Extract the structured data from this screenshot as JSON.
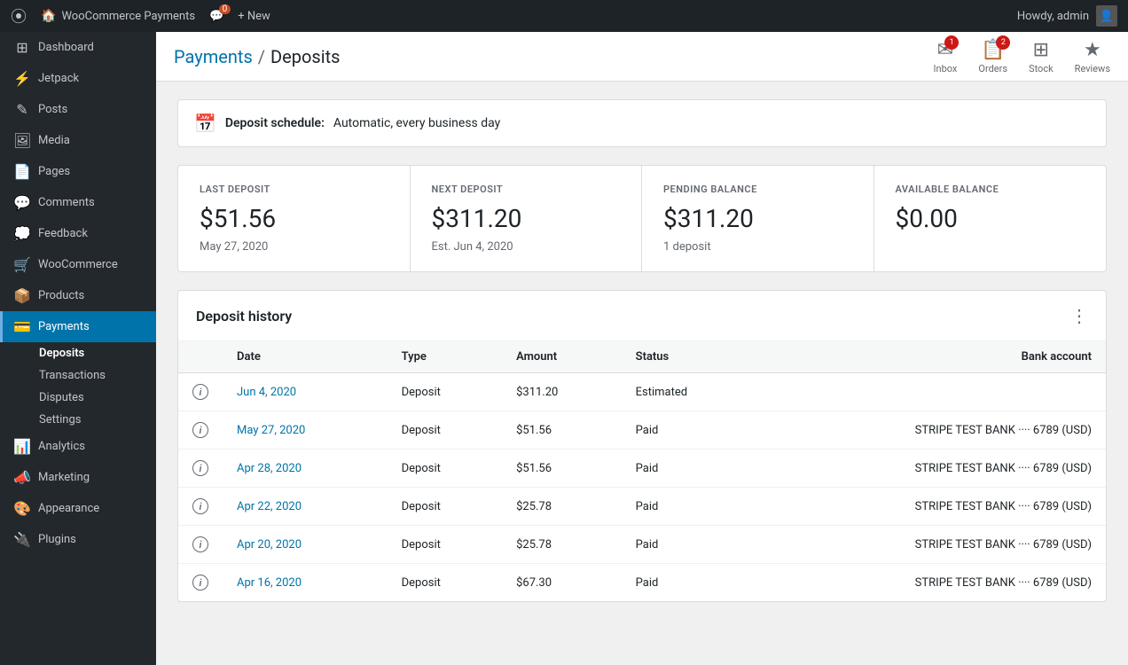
{
  "adminBar": {
    "logo": "W",
    "siteName": "WooCommerce Payments",
    "comments": "0",
    "newLabel": "+ New",
    "userLabel": "Howdy, admin"
  },
  "sidebar": {
    "items": [
      {
        "id": "dashboard",
        "label": "Dashboard",
        "icon": "⊞"
      },
      {
        "id": "jetpack",
        "label": "Jetpack",
        "icon": "⚡"
      },
      {
        "id": "posts",
        "label": "Posts",
        "icon": "✎"
      },
      {
        "id": "media",
        "label": "Media",
        "icon": "🖼"
      },
      {
        "id": "pages",
        "label": "Pages",
        "icon": "📄"
      },
      {
        "id": "comments",
        "label": "Comments",
        "icon": "💬"
      },
      {
        "id": "feedback",
        "label": "Feedback",
        "icon": "💭"
      },
      {
        "id": "woocommerce",
        "label": "WooCommerce",
        "icon": "🛒"
      },
      {
        "id": "products",
        "label": "Products",
        "icon": "📦"
      },
      {
        "id": "payments",
        "label": "Payments",
        "icon": "💳",
        "active": true
      }
    ],
    "paymentsSubItems": [
      {
        "id": "deposits",
        "label": "Deposits",
        "active": true
      },
      {
        "id": "transactions",
        "label": "Transactions"
      },
      {
        "id": "disputes",
        "label": "Disputes"
      },
      {
        "id": "settings",
        "label": "Settings"
      }
    ],
    "bottomItems": [
      {
        "id": "analytics",
        "label": "Analytics",
        "icon": "📊"
      },
      {
        "id": "marketing",
        "label": "Marketing",
        "icon": "📣"
      },
      {
        "id": "appearance",
        "label": "Appearance",
        "icon": "🎨"
      },
      {
        "id": "plugins",
        "label": "Plugins",
        "icon": "🔌"
      }
    ]
  },
  "header": {
    "breadcrumbLink": "Payments",
    "breadcrumbCurrent": "Deposits",
    "actions": [
      {
        "id": "inbox",
        "label": "Inbox",
        "icon": "✉",
        "badge": "1"
      },
      {
        "id": "orders",
        "label": "Orders",
        "icon": "📋",
        "badge": "2"
      },
      {
        "id": "stock",
        "label": "Stock",
        "icon": "⊞",
        "badge": null
      },
      {
        "id": "reviews",
        "label": "Reviews",
        "icon": "★",
        "badge": null
      }
    ]
  },
  "depositSchedule": {
    "label": "Deposit schedule:",
    "value": "Automatic, every business day"
  },
  "summaryCards": [
    {
      "id": "last-deposit",
      "label": "LAST DEPOSIT",
      "value": "$51.56",
      "sub": "May 27, 2020"
    },
    {
      "id": "next-deposit",
      "label": "NEXT DEPOSIT",
      "value": "$311.20",
      "sub": "Est. Jun 4, 2020"
    },
    {
      "id": "pending-balance",
      "label": "PENDING BALANCE",
      "value": "$311.20",
      "sub": "1 deposit"
    },
    {
      "id": "available-balance",
      "label": "AVAILABLE BALANCE",
      "value": "$0.00",
      "sub": ""
    }
  ],
  "depositHistory": {
    "title": "Deposit history",
    "columns": [
      "Date",
      "Type",
      "Amount",
      "Status",
      "Bank account"
    ],
    "rows": [
      {
        "date": "Jun 4, 2020",
        "type": "Deposit",
        "amount": "$311.20",
        "status": "Estimated",
        "bankAccount": ""
      },
      {
        "date": "May 27, 2020",
        "type": "Deposit",
        "amount": "$51.56",
        "status": "Paid",
        "bankAccount": "STRIPE TEST BANK ···· 6789 (USD)"
      },
      {
        "date": "Apr 28, 2020",
        "type": "Deposit",
        "amount": "$51.56",
        "status": "Paid",
        "bankAccount": "STRIPE TEST BANK ···· 6789 (USD)"
      },
      {
        "date": "Apr 22, 2020",
        "type": "Deposit",
        "amount": "$25.78",
        "status": "Paid",
        "bankAccount": "STRIPE TEST BANK ···· 6789 (USD)"
      },
      {
        "date": "Apr 20, 2020",
        "type": "Deposit",
        "amount": "$25.78",
        "status": "Paid",
        "bankAccount": "STRIPE TEST BANK ···· 6789 (USD)"
      },
      {
        "date": "Apr 16, 2020",
        "type": "Deposit",
        "amount": "$67.30",
        "status": "Paid",
        "bankAccount": "STRIPE TEST BANK ···· 6789 (USD)"
      }
    ]
  }
}
